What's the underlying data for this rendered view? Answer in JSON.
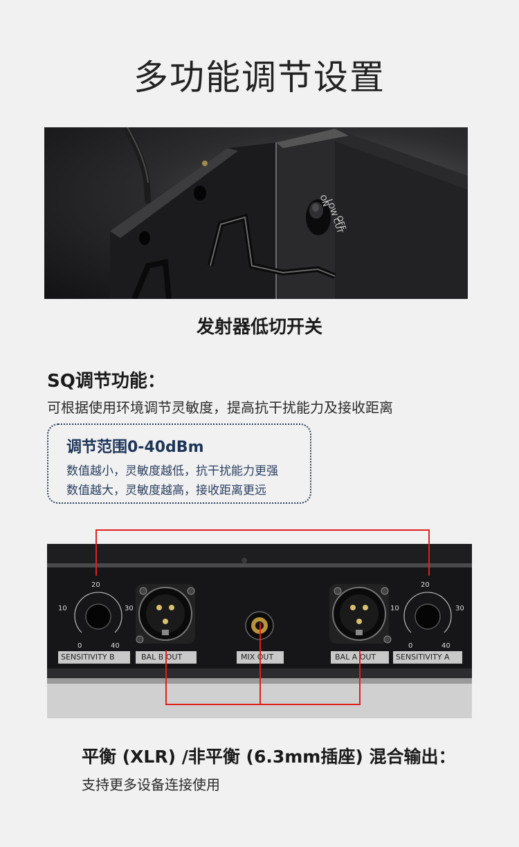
{
  "page": {
    "title": "多功能调节设置"
  },
  "transmitter_photo": {
    "switch_label_top": "LOW CUT",
    "switch_on": "ON",
    "switch_off": "OFF",
    "caption": "发射器低切开关"
  },
  "sq_section": {
    "heading": "SQ调节功能：",
    "description": "可根据使用环境调节灵敏度，提高抗干扰能力及接收距离",
    "range_box": {
      "title": "调节范围0-40dBm",
      "lines": [
        "数值越小，灵敏度越低，抗干扰能力更强",
        "数值越大，灵敏度越高，接收距离更远"
      ]
    }
  },
  "rear_panel": {
    "knob_ticks": [
      "20",
      "10",
      "30",
      "0",
      "40"
    ],
    "labels": {
      "sensitivity_b": "SENSITIVITY B",
      "bal_b_out": "BAL B OUT",
      "mix_out": "MIX OUT",
      "bal_a_out": "BAL A OUT",
      "sensitivity_a": "SENSITIVITY A"
    },
    "connector_color": "#e0201c"
  },
  "output_section": {
    "heading": "平衡 (XLR) /非平衡 (6.3mm插座) 混合输出：",
    "description": "支持更多设备连接使用"
  }
}
